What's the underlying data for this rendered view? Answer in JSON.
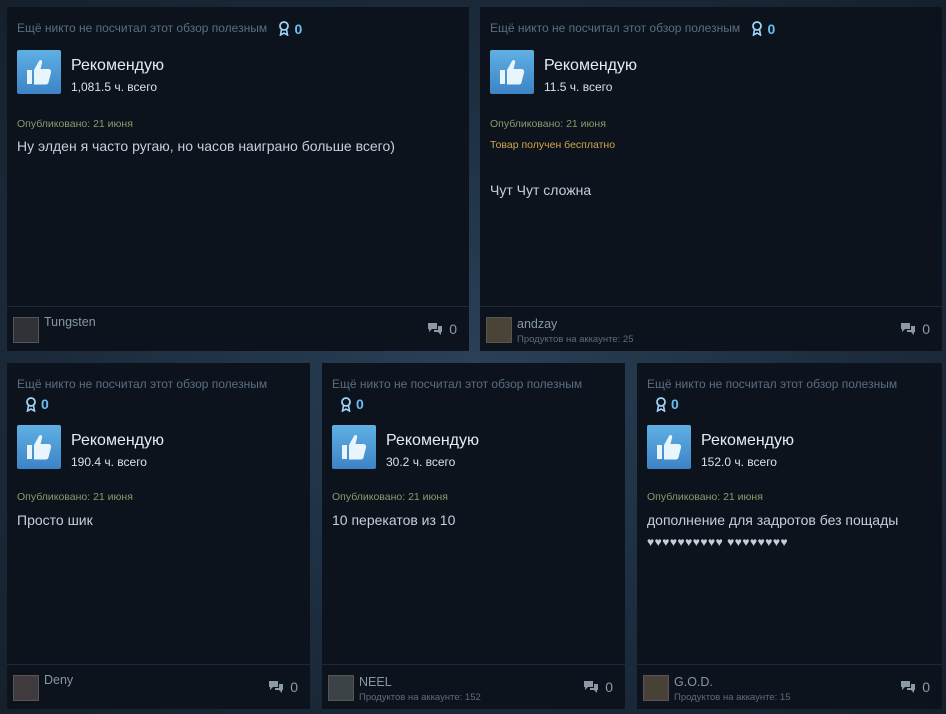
{
  "reviews": [
    {
      "helpful_text": "Ещё никто не посчитал этот обзор полезным",
      "awards": "0",
      "recommend": "Рекомендую",
      "hours": "1,081.5 ч. всего",
      "posted": "Опубликовано: 21 июня",
      "free": "",
      "body": "Ну элден я часто ругаю, но часов наиграно больше всего)",
      "user": "Tungsten",
      "products": "",
      "comments": "0"
    },
    {
      "helpful_text": "Ещё никто не посчитал этот обзор полезным",
      "awards": "0",
      "recommend": "Рекомендую",
      "hours": "11.5 ч. всего",
      "posted": "Опубликовано: 21 июня",
      "free": "Товар получен бесплатно",
      "body": "Чут Чут сложна",
      "user": "andzay",
      "products": "Продуктов на аккаунте: 25",
      "comments": "0"
    },
    {
      "helpful_text": "Ещё никто не посчитал этот обзор полезным",
      "awards": "0",
      "recommend": "Рекомендую",
      "hours": "190.4 ч. всего",
      "posted": "Опубликовано: 21 июня",
      "free": "",
      "body": "Просто шик",
      "user": "Deny",
      "products": "",
      "comments": "0"
    },
    {
      "helpful_text": "Ещё никто не посчитал этот обзор полезным",
      "awards": "0",
      "recommend": "Рекомендую",
      "hours": "30.2 ч. всего",
      "posted": "Опубликовано: 21 июня",
      "free": "",
      "body": "10 перекатов из 10",
      "user": "NEEL",
      "products": "Продуктов на аккаунте: 152",
      "comments": "0"
    },
    {
      "helpful_text": "Ещё никто не посчитал этот обзор полезным",
      "awards": "0",
      "recommend": "Рекомендую",
      "hours": "152.0 ч. всего",
      "posted": "Опубликовано: 21 июня",
      "free": "",
      "body": "дополнение для задротов без пощады",
      "body2": "♥♥♥♥♥♥♥♥♥♥ ♥♥♥♥♥♥♥♥",
      "user": "G.O.D.",
      "products": "Продуктов на аккаунте: 15",
      "comments": "0"
    }
  ],
  "icons": {
    "thumb": "thumbs-up-icon",
    "award": "award-ribbon-icon",
    "comment": "comment-bubbles-icon"
  },
  "colors": {
    "accent": "#66c0f4",
    "thumb_bg": "#4a98d6",
    "card_bg": "#0c131d",
    "free_text": "#d5a24a"
  }
}
